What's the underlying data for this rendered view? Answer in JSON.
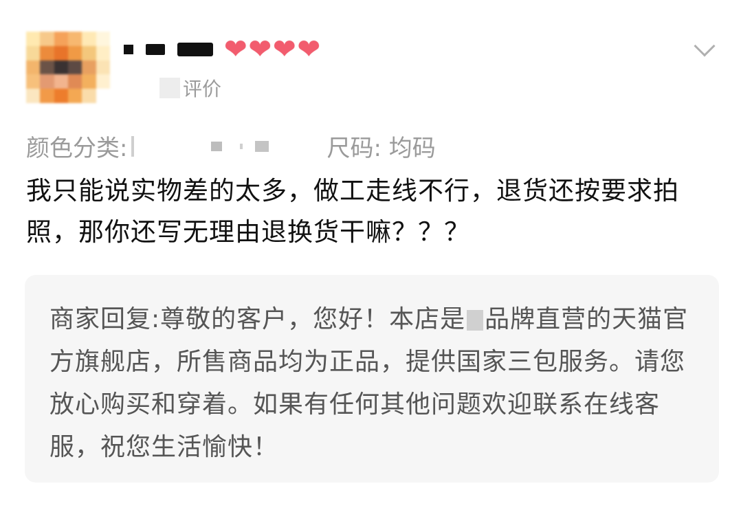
{
  "review": {
    "hearts": [
      "❤",
      "❤",
      "❤",
      "❤"
    ],
    "sub_label": "评价",
    "spec_color_label": "颜色分类:",
    "spec_size": "尺码: 均码",
    "text": "我只能说实物差的太多，做工走线不行，退货还按要求拍照，那你还写无理由退换货干嘛？？？"
  },
  "reply": {
    "text_before": "商家回复:尊敬的客户，您好！本店是",
    "text_after": "品牌直营的天猫官方旗舰店，所售商品均为正品，提供国家三包服务。请您放心购买和穿着。如果有任何其他问题欢迎联系在线客服，祝您生活愉快！"
  },
  "colors": {
    "heart": "#f25c6e",
    "reply_bg": "#f6f6f6",
    "muted_text": "#9a9a9a"
  },
  "icons": {
    "avatar": "pixelated-avatar",
    "expand": "chevron-down-icon"
  }
}
